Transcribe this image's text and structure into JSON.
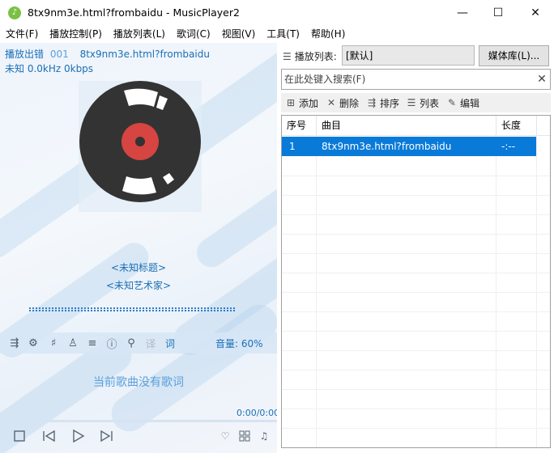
{
  "window": {
    "title": "8tx9nm3e.html?frombaidu - MusicPlayer2",
    "minimize": "—",
    "maximize": "☐",
    "close": "✕"
  },
  "menu": [
    {
      "label": "文件(F)"
    },
    {
      "label": "播放控制(P)"
    },
    {
      "label": "播放列表(L)"
    },
    {
      "label": "歌词(C)"
    },
    {
      "label": "视图(V)"
    },
    {
      "label": "工具(T)"
    },
    {
      "label": "帮助(H)"
    }
  ],
  "player": {
    "status": "播放出错",
    "track_no": "001",
    "file_name": "8tx9nm3e.html?frombaidu",
    "format_info": "未知 0.0kHz 0kbps",
    "song_title": "<未知标题>",
    "artist": "<未知艺术家>",
    "volume": "音量: 60%",
    "lyric_button": "词",
    "translate_button": "译",
    "no_lyric": "当前歌曲没有歌词",
    "time": "0:00/0:00",
    "progress": 0
  },
  "playlist": {
    "label": "播放列表:",
    "current": "[默认]",
    "media_lib_button": "媒体库(L)...",
    "search_placeholder": "在此处键入搜索(F)",
    "toolbar": {
      "add": "添加",
      "delete": "删除",
      "sort": "排序",
      "list": "列表",
      "edit": "编辑"
    },
    "columns": [
      "序号",
      "曲目",
      "长度"
    ],
    "rows": [
      {
        "no": "1",
        "track": "8tx9nm3e.html?frombaidu",
        "length": "-:--"
      }
    ]
  },
  "colors": {
    "accent": "#1a6fb5",
    "selection": "#0a7ad9",
    "disc": "#333333",
    "disc_label": "#d64541"
  }
}
